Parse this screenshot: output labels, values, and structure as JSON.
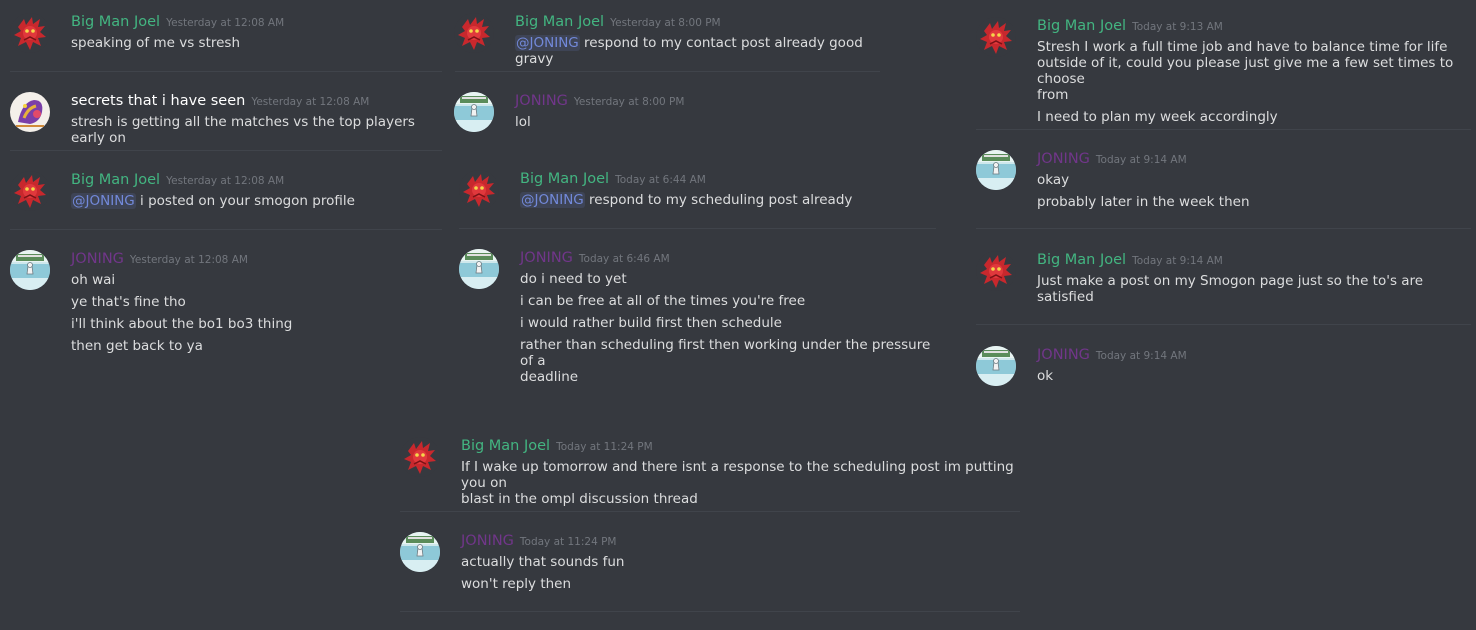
{
  "colors": {
    "background": "#36393f",
    "divider": "#40444b",
    "timestamp": "#72767d",
    "text": "#dcddde",
    "mention": "#7289da",
    "role_green": "#43b581",
    "role_purple": "#71368a",
    "role_white": "#ffffff"
  },
  "icons": {
    "red_avatar": "red-pokemon-avatar-icon",
    "joning_avatar": "joning-avatar-icon",
    "secrets_avatar": "secrets-avatar-icon"
  },
  "col1": [
    {
      "author": "Big Man Joel",
      "timestamp": "Yesterday at 12:08 AM",
      "lines": [
        "speaking of me vs stresh"
      ]
    },
    {
      "author": "secrets that i have seen",
      "timestamp": "Yesterday at 12:08 AM",
      "lines": [
        "stresh is getting all the matches vs the top players early on"
      ]
    },
    {
      "author": "Big Man Joel",
      "timestamp": "Yesterday at 12:08 AM",
      "mention": "@JONING",
      "lines": [
        " i posted on your smogon profile"
      ]
    },
    {
      "author": "JONING",
      "timestamp": "Yesterday at 12:08 AM",
      "lines": [
        "oh wai",
        "ye that's fine tho",
        "i'll think about the bo1 bo3 thing",
        "then get back to ya"
      ]
    }
  ],
  "col2": [
    {
      "author": "Big Man Joel",
      "timestamp": "Yesterday at 8:00 PM",
      "mention": "@JONING",
      "lines": [
        " respond to my contact post already good gravy"
      ]
    },
    {
      "author": "JONING",
      "timestamp": "Yesterday at 8:00 PM",
      "lines": [
        "lol"
      ]
    },
    {
      "author": "Big Man Joel",
      "timestamp": "Today at 6:44 AM",
      "mention": "@JONING",
      "lines": [
        " respond to my scheduling post already"
      ]
    },
    {
      "author": "JONING",
      "timestamp": "Today at 6:46 AM",
      "lines": [
        "do i need to yet",
        "i can be free at all of the times you're free",
        "i would rather build first then schedule",
        "rather than scheduling first then working under the pressure of a",
        "deadline"
      ]
    }
  ],
  "col3": [
    {
      "author": "Big Man Joel",
      "timestamp": "Today at 9:13 AM",
      "lines": [
        "Stresh I work a full time job and have to balance time for life",
        "outside of it, could you please just give me a few set times to choose",
        "from",
        "I need to plan my week accordingly"
      ]
    },
    {
      "author": "JONING",
      "timestamp": "Today at 9:14 AM",
      "lines": [
        "okay",
        "probably later in the week then"
      ]
    },
    {
      "author": "Big Man Joel",
      "timestamp": "Today at 9:14 AM",
      "lines": [
        "Just make a post on my Smogon page just so the to's are",
        "satisfied"
      ]
    },
    {
      "author": "JONING",
      "timestamp": "Today at 9:14 AM",
      "lines": [
        "ok"
      ]
    }
  ],
  "col4": [
    {
      "author": "Big Man Joel",
      "timestamp": "Today at 11:24 PM",
      "lines": [
        "If I wake up tomorrow and there isnt a response to the scheduling post im putting you on",
        "blast in the ompl discussion thread"
      ]
    },
    {
      "author": "JONING",
      "timestamp": "Today at 11:24 PM",
      "lines": [
        "actually that sounds fun",
        "won't reply then"
      ]
    }
  ]
}
